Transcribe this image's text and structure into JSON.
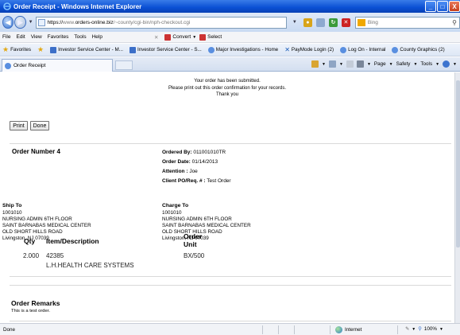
{
  "window": {
    "title": "Order Receipt - Windows Internet Explorer",
    "controls": [
      "_",
      "□",
      "X"
    ]
  },
  "address_bar": {
    "url_prefix": "https://",
    "url_gray1": "www.",
    "url_host": "orders-online.biz",
    "url_path": "/~county/cgi-bin/nph-checkout.cgi",
    "search_placeholder": "Bing"
  },
  "menu": {
    "items": [
      "File",
      "Edit",
      "View",
      "Favorites",
      "Tools",
      "Help"
    ],
    "convert_label": "Convert",
    "select_label": "Select"
  },
  "favorites": {
    "label": "Favorites",
    "links": [
      "Investor Service Center - M...",
      "Investor Service Center - S...",
      "Major Investigations - Home",
      "PayMode Login (2)",
      "Log On - Internal",
      "County Graphics (2)"
    ]
  },
  "tab": {
    "label": "Order Receipt"
  },
  "commandbar": {
    "page_label": "Page",
    "safety_label": "Safety",
    "tools_label": "Tools"
  },
  "notice": {
    "line1": "Your order has been submitted.",
    "line2": "Please print out this order confirmation for your records.",
    "line3": "Thank you"
  },
  "buttons": {
    "print": "Print",
    "done": "Done"
  },
  "order": {
    "number_label": "Order Number",
    "number_value": "4",
    "ordered_by_label": "Ordered By:",
    "ordered_by_value": "011001010TR",
    "order_date_label": "Order Date:",
    "order_date_value": "01/14/2013",
    "attention_label": "Attention :",
    "attention_value": "Joe",
    "client_po_label": "Client PO/Req. # :",
    "client_po_value": "Test Order"
  },
  "ship_to": {
    "header": "Ship To",
    "lines": [
      "1001010",
      "NURSING ADMIN 6TH FLOOR",
      "SAINT BARNABAS MEDICAL CENTER",
      "OLD SHORT HILLS ROAD",
      "Livingston, NJ 07039"
    ]
  },
  "charge_to": {
    "header": "Charge To",
    "lines": [
      "1001010",
      "NURSING ADMIN 6TH FLOOR",
      "SAINT BARNABAS MEDICAL CENTER",
      "OLD SHORT HILLS ROAD",
      "Livingston, NJ 07039"
    ]
  },
  "items_table": {
    "col_qty": "Qty",
    "col_item": "Item/Description",
    "col_unit_line1": "Order",
    "col_unit_line2": "Unit",
    "rows": [
      {
        "qty": "2.000",
        "item": "42385",
        "description": "L.H.HEALTH CARE SYSTEMS",
        "unit": "BX/500"
      }
    ]
  },
  "remarks": {
    "header": "Order Remarks",
    "text": "This is a test order."
  },
  "status": {
    "left": "Done",
    "zone": "Internet",
    "zoom": "100%"
  },
  "colors": {
    "titlebar": "#0a4fd4",
    "close_button": "#c8401c",
    "favorites_star": "#e3a813"
  }
}
